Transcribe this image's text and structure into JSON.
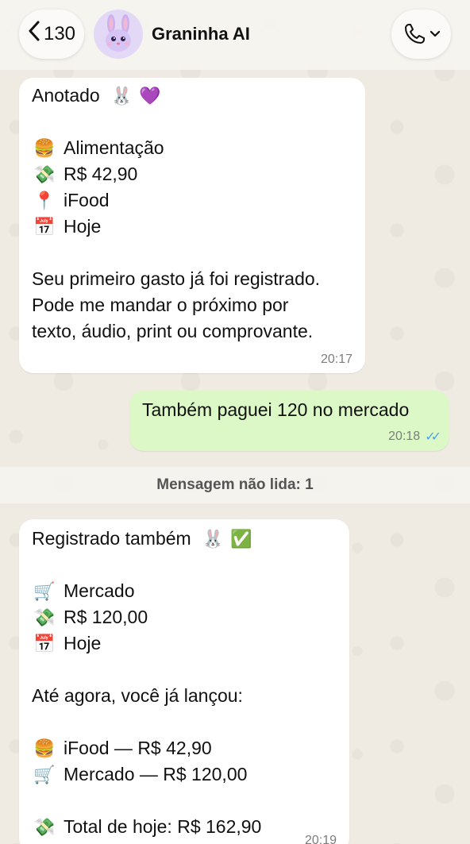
{
  "header": {
    "back_count": "130",
    "contact_name": "Graninha AI"
  },
  "messages": [
    {
      "direction": "in",
      "lines": [
        {
          "text": "Anotado",
          "emoji_after": [
            "🐰",
            "💜"
          ]
        },
        {
          "text": ""
        },
        {
          "emoji": "🍔",
          "text": "Alimentação"
        },
        {
          "emoji": "💸",
          "text": "R$ 42,90"
        },
        {
          "emoji": "📍",
          "text": "iFood"
        },
        {
          "emoji": "📅",
          "text": "Hoje"
        },
        {
          "text": ""
        },
        {
          "text": "Seu primeiro gasto já foi registrado."
        },
        {
          "text": "Pode me mandar o próximo por"
        },
        {
          "text": "texto, áudio, print ou comprovante."
        }
      ],
      "time": "20:17"
    },
    {
      "direction": "out",
      "lines": [
        {
          "text": "Também paguei 120 no mercado"
        }
      ],
      "time": "20:18",
      "read": true
    },
    {
      "direction": "in",
      "lines": [
        {
          "text": "Registrado também",
          "emoji_after": [
            "🐰",
            "✅"
          ]
        },
        {
          "text": ""
        },
        {
          "emoji": "🛒",
          "text": "Mercado"
        },
        {
          "emoji": "💸",
          "text": "R$ 120,00"
        },
        {
          "emoji": "📅",
          "text": "Hoje"
        },
        {
          "text": ""
        },
        {
          "text": "Até agora, você já lançou:"
        },
        {
          "text": ""
        },
        {
          "emoji": "🍔",
          "text": "iFood — R$ 42,90"
        },
        {
          "emoji": "🛒",
          "text": "Mercado — R$ 120,00"
        },
        {
          "text": ""
        },
        {
          "emoji": "💸",
          "text": "Total de hoje: R$ 162,90"
        }
      ],
      "time": "20:19"
    }
  ],
  "unread_label": "Mensagem não lida: 1",
  "colors": {
    "wallpaper": "#efeae2",
    "incoming": "#ffffff",
    "outgoing": "#dcf8c6",
    "read_ticks": "#4fa3e6"
  },
  "icons": {
    "back": "chevron-left-icon",
    "avatar": "bunny-avatar-icon",
    "call": "phone-icon"
  }
}
